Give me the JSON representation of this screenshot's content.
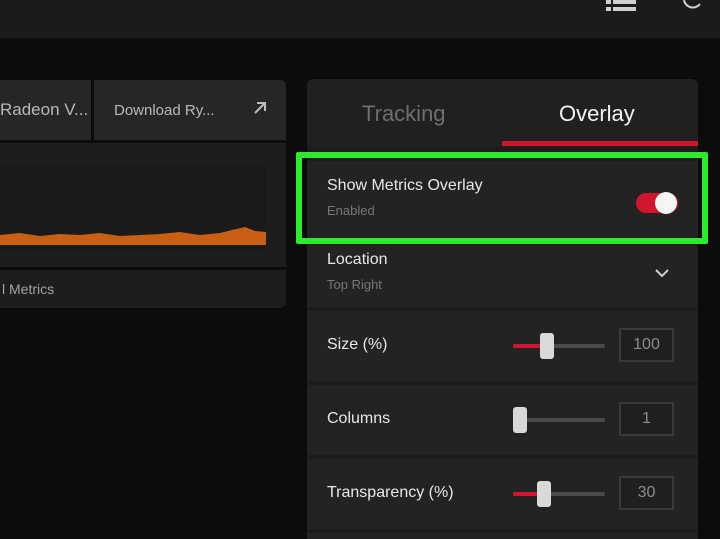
{
  "topbar": {
    "icons": [
      "list-icon",
      "refresh-icon"
    ]
  },
  "left": {
    "tab1_label": "Radeon V...",
    "tab2_label": "Download Ry...",
    "tab2_icon": "external-arrow-icon",
    "metrics_label": "l Metrics",
    "graph_color": "#d86a16"
  },
  "panel": {
    "tabs": [
      {
        "label": "Tracking",
        "active": false
      },
      {
        "label": "Overlay",
        "active": true
      }
    ],
    "accent": "#d0162f",
    "highlight_color": "#2dea2d",
    "show_metrics": {
      "label": "Show Metrics Overlay",
      "status": "Enabled",
      "enabled": true
    },
    "location": {
      "label": "Location",
      "value": "Top Right"
    },
    "size": {
      "label": "Size (%)",
      "value": "100",
      "level": 0.37
    },
    "columns": {
      "label": "Columns",
      "value": "1",
      "level": 0.0
    },
    "transparency": {
      "label": "Transparency (%)",
      "value": "30",
      "level": 0.34
    }
  }
}
